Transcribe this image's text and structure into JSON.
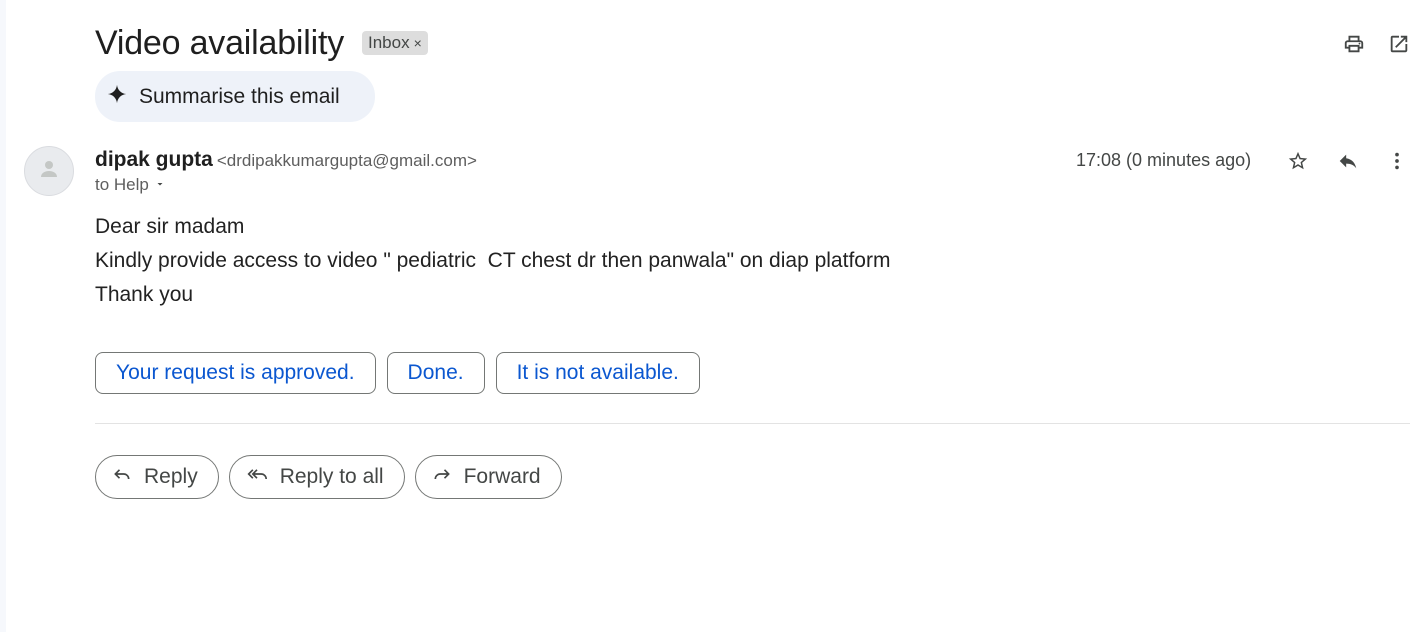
{
  "email": {
    "subject": "Video availability",
    "label": "Inbox",
    "label_remove": "×",
    "summarise_label": "Summarise this email",
    "sender": {
      "name": "dipak gupta",
      "email": "<drdipakkumargupta@gmail.com>"
    },
    "to_line": "to Help",
    "time": "17:08 (0 minutes ago)",
    "body": [
      "Dear sir madam",
      "Kindly provide access to video \" pediatric  CT chest dr then panwala\" on diap platform",
      "Thank you"
    ]
  },
  "smart_replies": [
    "Your request is approved.",
    "Done.",
    "It is not available."
  ],
  "actions": {
    "reply": "Reply",
    "reply_all": "Reply to all",
    "forward": "Forward"
  },
  "icons": {
    "print": "print-icon",
    "open_new_window": "open-in-new-window-icon",
    "sparkle": "sparkle-icon",
    "avatar": "person-icon",
    "dropdown": "caret-down-icon",
    "star": "star-icon",
    "reply": "reply-icon",
    "more": "more-vertical-icon",
    "reply_all": "reply-all-icon",
    "forward": "forward-icon"
  },
  "colors": {
    "link_blue": "#0b57d0",
    "chip_bg": "#dddddd",
    "summarise_bg": "#eef2f9"
  }
}
